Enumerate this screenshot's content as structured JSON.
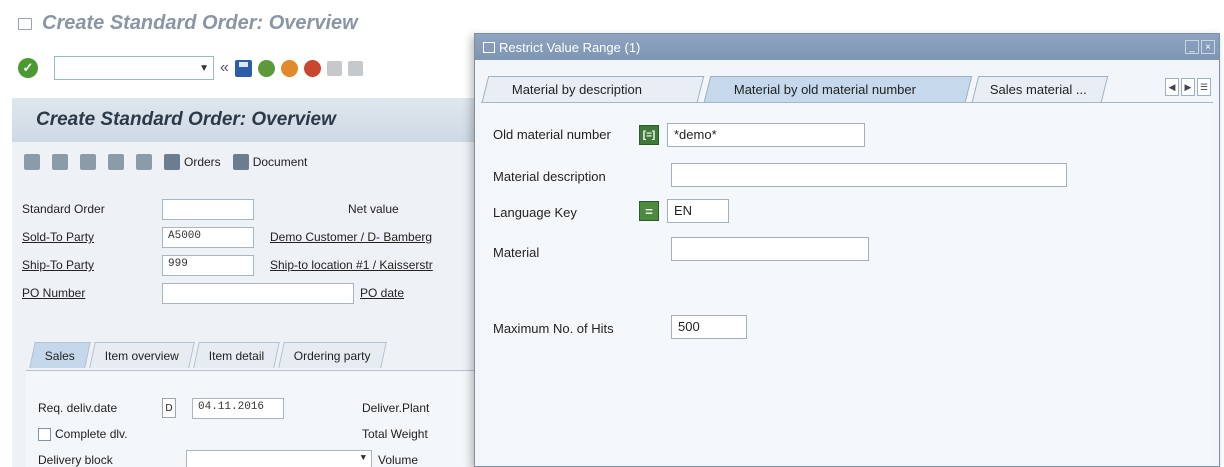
{
  "window": {
    "title": "Create Standard Order: Overview"
  },
  "toolbar": {
    "command_value": "",
    "nav_back_glyph": "«"
  },
  "panel": {
    "header": "Create Standard Order: Overview",
    "orders_label": "Orders",
    "document_label": "Document"
  },
  "header_fields": {
    "standard_order_label": "Standard Order",
    "standard_order_value": "",
    "net_value_label": "Net value",
    "sold_to_label": "Sold-To Party",
    "sold_to_value": "A5000",
    "sold_to_desc": "Demo Customer / D- Bamberg",
    "ship_to_label": "Ship-To Party",
    "ship_to_value": "999",
    "ship_to_desc": "Ship-to location #1 / Kaisserstr",
    "po_number_label": "PO Number",
    "po_number_value": "",
    "po_date_label": "PO date"
  },
  "tabs": [
    "Sales",
    "Item overview",
    "Item detail",
    "Ordering party"
  ],
  "sales_tab": {
    "req_deliv_label": "Req. deliv.date",
    "req_deliv_tag": "D",
    "req_deliv_value": "04.11.2016",
    "deliver_plant_label": "Deliver.Plant",
    "complete_dlv_label": "Complete dlv.",
    "total_weight_label": "Total Weight",
    "delivery_block_label": "Delivery block",
    "volume_label": "Volume"
  },
  "dialog": {
    "title": "Restrict Value Range (1)",
    "tabs": [
      "Material by description",
      "Material by old material number",
      "Sales material ..."
    ],
    "old_material_label": "Old material number",
    "old_material_op": "[=]",
    "old_material_value": "*demo*",
    "material_desc_label": "Material description",
    "material_desc_value": "",
    "language_key_label": "Language Key",
    "language_key_op": "=",
    "language_key_value": "EN",
    "material_label": "Material",
    "material_value": "",
    "max_hits_label": "Maximum No. of Hits",
    "max_hits_value": "500"
  }
}
